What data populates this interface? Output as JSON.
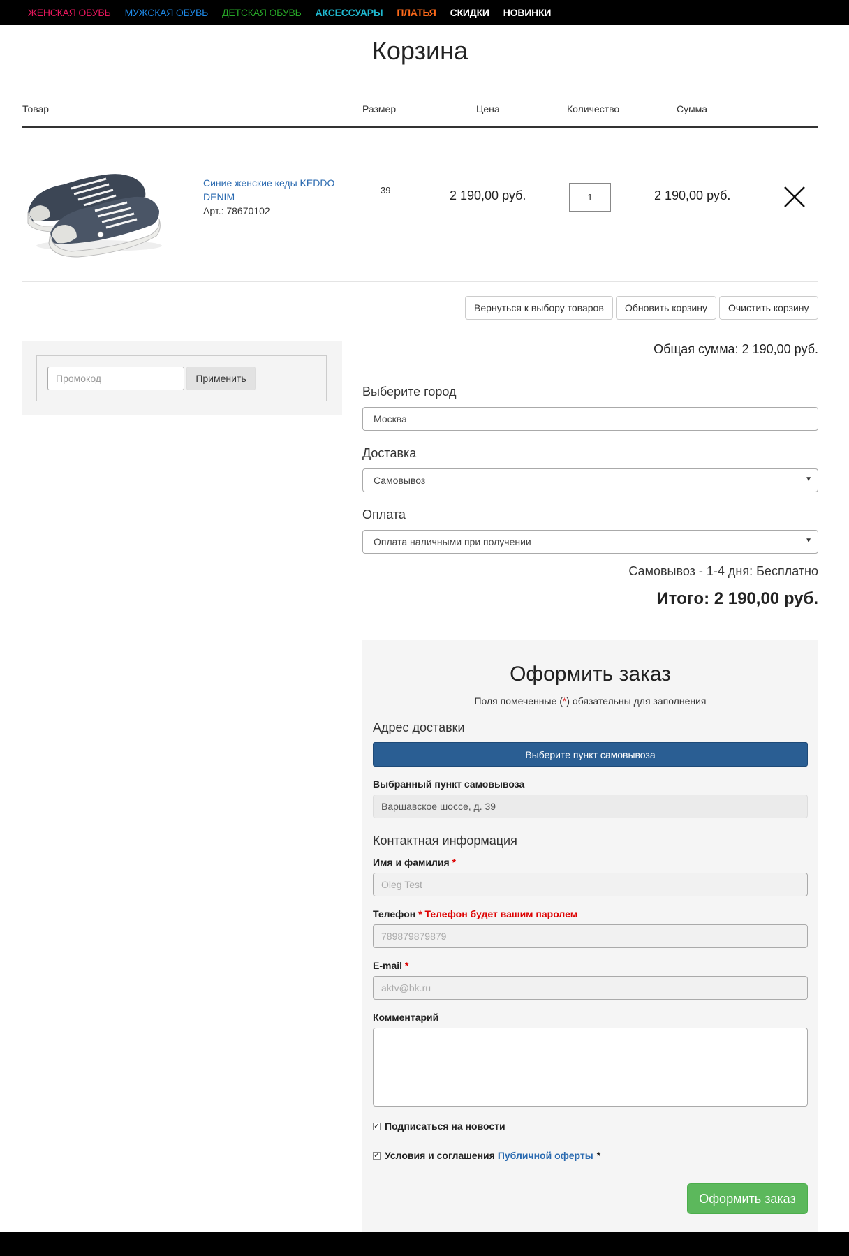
{
  "nav": {
    "items": [
      {
        "label": "Женская обувь",
        "color": "#e8175d"
      },
      {
        "label": "Мужская обувь",
        "color": "#1e88e5"
      },
      {
        "label": "Детская обувь",
        "color": "#27a527"
      },
      {
        "label": "Аксессуары",
        "color": "#1fb8cf"
      },
      {
        "label": "Платья",
        "color": "#ff6a1a"
      },
      {
        "label": "Скидки",
        "color": "#ffffff"
      },
      {
        "label": "Новинки",
        "color": "#ffffff"
      }
    ]
  },
  "page": {
    "title": "Корзина"
  },
  "table": {
    "headers": {
      "product": "Товар",
      "size": "Размер",
      "price": "Цена",
      "quantity": "Количество",
      "sum": "Сумма"
    }
  },
  "cart_item": {
    "name": "Синие женские кеды KEDDO DENIM",
    "article": "Арт.: 78670102",
    "size": "39",
    "price": "2 190,00 руб.",
    "quantity": "1",
    "sum": "2 190,00 руб.",
    "image_icon": "sneakers-image",
    "remove_icon": "close-icon"
  },
  "actions": {
    "back": "Вернуться к выбору товаров",
    "update": "Обновить корзину",
    "clear": "Очистить корзину"
  },
  "promo": {
    "placeholder": "Промокод",
    "apply": "Применить"
  },
  "summary": {
    "total_label": "Общая сумма: 2 190,00 руб.",
    "city_label": "Выберите город",
    "city_value": "Москва",
    "delivery_label": "Доставка",
    "delivery_value": "Самовывоз",
    "payment_label": "Оплата",
    "payment_value": "Оплата наличными при получении",
    "delivery_info": "Самовывоз - 1-4 дня: Бесплатно",
    "grand_total": "Итого: 2 190,00 руб."
  },
  "order": {
    "title": "Оформить заказ",
    "note_prefix": "Поля помеченные (",
    "note_star": "*",
    "note_suffix": ") обязательны для заполнения",
    "address_head": "Адрес доставки",
    "pickup_button": "Выберите пункт самовывоза",
    "pickup_selected_label": "Выбранный пункт самовывоза",
    "pickup_selected_value": "Варшавское шоссе, д. 39",
    "contact_head": "Контактная информация",
    "name_label": "Имя и фамилия",
    "name_placeholder": "Oleg Test",
    "phone_label": "Телефон",
    "phone_note": "Телефон будет вашим паролем",
    "phone_placeholder": "789879879879",
    "email_label": "E-mail",
    "email_placeholder": "aktv@bk.ru",
    "comment_label": "Комментарий",
    "required_star": "*",
    "subscribe_label": "Подписаться на новости",
    "terms_label": "Условия и соглашения",
    "terms_link": "Публичной оферты",
    "submit": "Оформить заказ"
  }
}
